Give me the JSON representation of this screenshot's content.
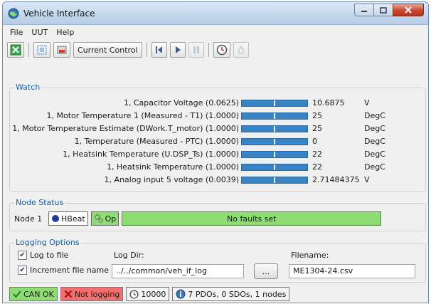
{
  "window": {
    "title": "Vehicle Interface",
    "icon": "globe-icon"
  },
  "menu": [
    "File",
    "UUT",
    "Help"
  ],
  "toolbar": {
    "current_control_label": "Current Control"
  },
  "watch": {
    "title": "Watch",
    "rows": [
      {
        "label": "1, Capacitor Voltage (0.0625)",
        "value": "10.6875",
        "unit": "V"
      },
      {
        "label": "1, Motor Temperature 1 (Measured - T1) (1.0000)",
        "value": "25",
        "unit": "DegC"
      },
      {
        "label": "1, Motor Temperature Estimate (DWork.T_motor) (1.0000)",
        "value": "25",
        "unit": "DegC"
      },
      {
        "label": "1, Temperature (Measured - PTC) (1.0000)",
        "value": "0",
        "unit": "DegC"
      },
      {
        "label": "1, Heatsink Temperature (U.DSP_Ts) (1.0000)",
        "value": "22",
        "unit": "DegC"
      },
      {
        "label": "1, Heatsink Temperature (1.0000)",
        "value": "22",
        "unit": "DegC"
      },
      {
        "label": "1, Analog input 5 voltage (0.0039)",
        "value": "2.71484375",
        "unit": "V"
      }
    ]
  },
  "node_status": {
    "title": "Node Status",
    "node": "Node 1",
    "hbeat": "HBeat",
    "op": "Op",
    "faults": "No faults set"
  },
  "logging": {
    "title": "Logging Options",
    "log_to_file_label": "Log to file",
    "log_to_file_checked": true,
    "increment_label": "Increment file name",
    "increment_checked": true,
    "log_dir_label": "Log Dir:",
    "log_dir_value": "../../common/veh_if_log",
    "browse_label": "...",
    "filename_label": "Filename:",
    "filename_value": "ME1304-24.csv"
  },
  "status": {
    "can": "CAN OK",
    "logging": "Not logging",
    "interval": "10000",
    "summary": "7 PDOs, 0 SDOs, 1 nodes"
  },
  "colors": {
    "ok_green": "#8fdc74",
    "error_red": "#f46f6f",
    "bar_blue": "#3b84c4",
    "group_title_blue": "#1b5da8"
  }
}
